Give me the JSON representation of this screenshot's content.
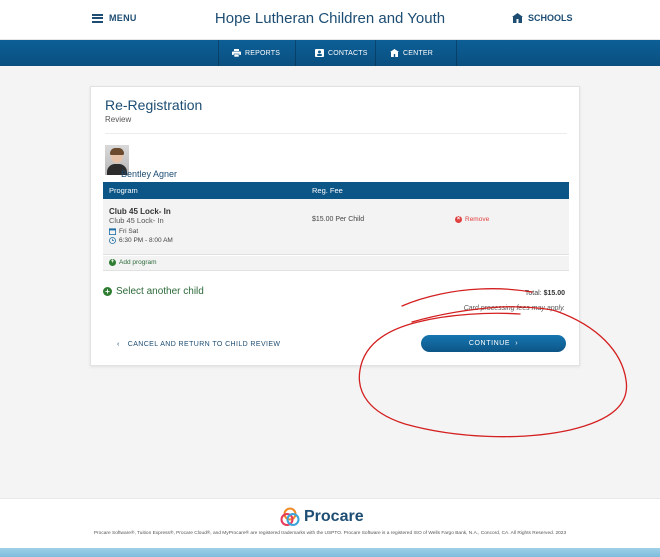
{
  "header": {
    "menu_label": "MENU",
    "org_name": "Hope Lutheran Children and Youth",
    "schools_label": "SCHOOLS"
  },
  "nav": {
    "items": [
      {
        "label": "REPORTS",
        "icon": "printer-icon"
      },
      {
        "label": "CONTACTS",
        "icon": "contact-card-icon"
      },
      {
        "label": "CENTER",
        "icon": "building-icon"
      }
    ]
  },
  "page": {
    "title": "Re-Registration",
    "subtitle": "Review"
  },
  "child": {
    "name": "Bentley Agner"
  },
  "table": {
    "columns": [
      "Program",
      "Reg. Fee"
    ],
    "rows": [
      {
        "program_name": "Club 45 Lock- In",
        "program_sub": "Club 45 Lock- In",
        "days": "Fri Sat",
        "time": "6:30 PM - 8:00 AM",
        "fee": "$15.00 Per Child",
        "remove_label": "Remove"
      }
    ],
    "add_program_label": "Add program"
  },
  "select_child_label": "Select another child",
  "totals": {
    "total_label": "Total:",
    "total_value": "$15.00",
    "fees_note": "Card processing fees may apply."
  },
  "actions": {
    "cancel_label": "CANCEL AND RETURN TO CHILD REVIEW",
    "continue_label": "CONTINUE"
  },
  "footer": {
    "logo_text": "Procare",
    "legal_text": "Procare Software®, Tuition Express®, Procare Cloud®, and MyProcare® are registered trademarks with the USPTO. Procare Software is a registered ISO of Wells Fargo Bank, N.A., Concord, CA. All Rights Reserved. 2023"
  },
  "colors": {
    "primary": "#0c5587",
    "brand_text": "#1d4d73",
    "add_green": "#2e7d32",
    "remove_red": "#e04040",
    "annotation_red": "#d42020"
  }
}
